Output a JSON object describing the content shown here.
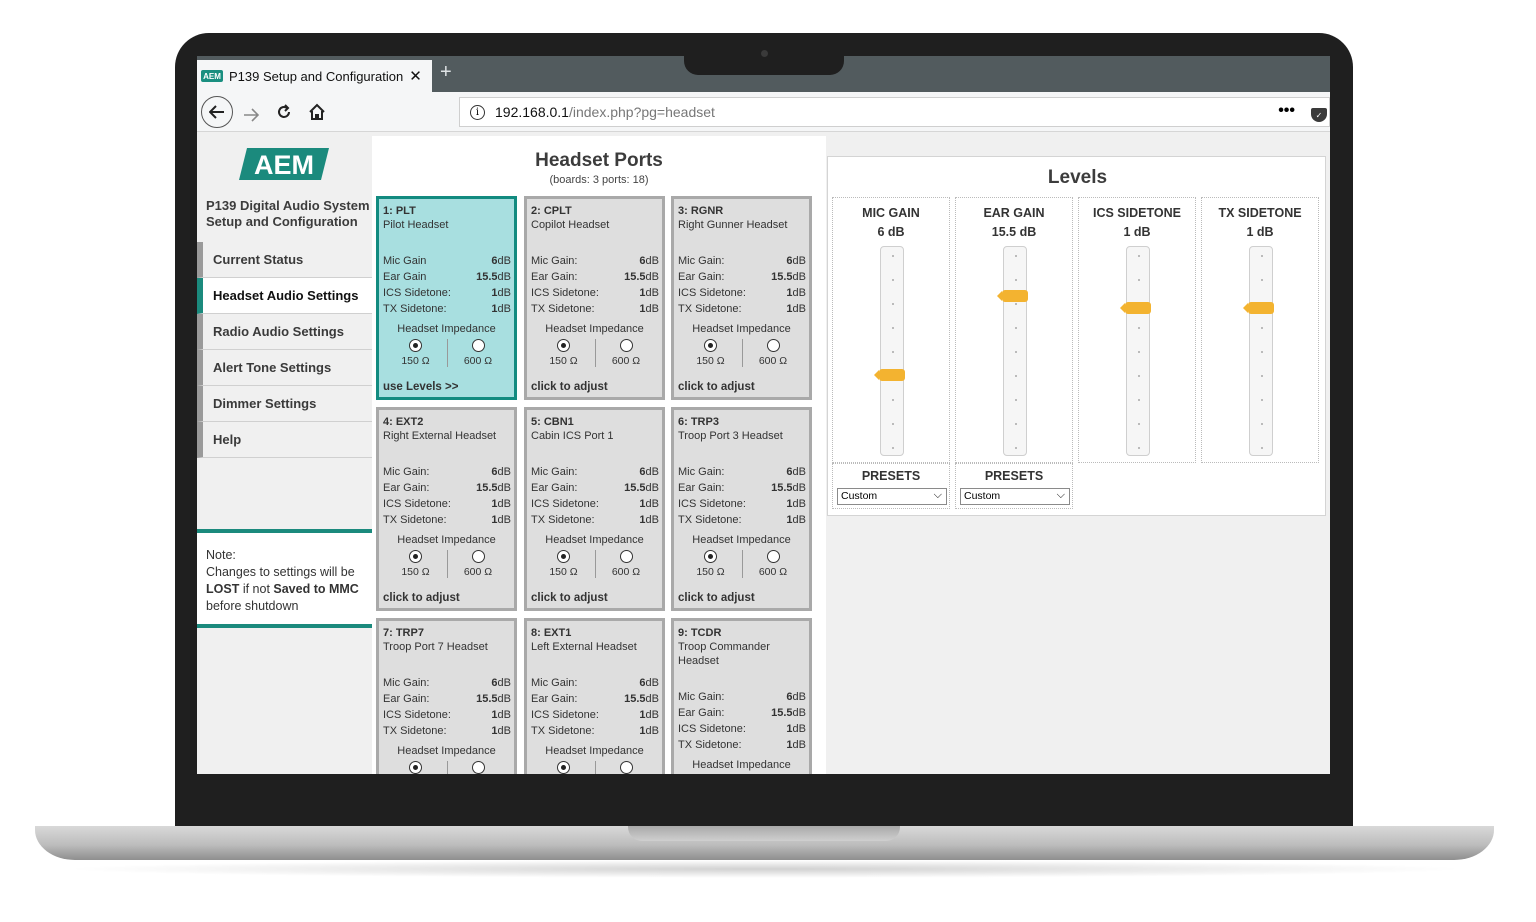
{
  "browser": {
    "tab_title": "P139 Setup and Configuration",
    "favicon_text": "AEM",
    "tab_close": "✕",
    "new_tab": "+",
    "url_host": "192.168.0.1",
    "url_path": "/index.php?pg=headset",
    "menu": "•••"
  },
  "sidebar": {
    "logo": "AEM",
    "system_title": "P139 Digital Audio System Setup and Configuration",
    "items": [
      {
        "label": "Current Status"
      },
      {
        "label": "Headset Audio Settings",
        "active": true
      },
      {
        "label": "Radio Audio Settings"
      },
      {
        "label": "Alert Tone Settings"
      },
      {
        "label": "Dimmer Settings"
      },
      {
        "label": "Help"
      }
    ],
    "note": {
      "title": "Note",
      "line1": "Changes to settings will be",
      "lost": "LOST",
      "if_not": " if not ",
      "saved": "Saved to MMC",
      "line3": "before shutdown"
    }
  },
  "headset_ports": {
    "title": "Headset Ports",
    "subtitle": "(boards: 3 ports: 18)",
    "impedance_label": "Headset Impedance",
    "imp_150": "150 Ω",
    "imp_600": "600 Ω",
    "ports": [
      {
        "id": "1: PLT",
        "name": "Pilot Headset",
        "mic_label": "Mic Gain",
        "ear_label": "Ear Gain",
        "mic": "6",
        "ear": "15.5",
        "ics": "1",
        "tx": "1",
        "footer": "use Levels >>",
        "selected": true
      },
      {
        "id": "2: CPLT",
        "name": "Copilot Headset",
        "mic_label": "Mic Gain:",
        "ear_label": "Ear Gain:",
        "mic": "6",
        "ear": "15.5",
        "ics": "1",
        "tx": "1",
        "footer": "click to adjust"
      },
      {
        "id": "3: RGNR",
        "name": "Right Gunner Headset",
        "mic_label": "Mic Gain:",
        "ear_label": "Ear Gain:",
        "mic": "6",
        "ear": "15.5",
        "ics": "1",
        "tx": "1",
        "footer": "click to adjust"
      },
      {
        "id": "4: EXT2",
        "name": "Right External Headset",
        "mic_label": "Mic Gain:",
        "ear_label": "Ear Gain:",
        "mic": "6",
        "ear": "15.5",
        "ics": "1",
        "tx": "1",
        "footer": "click to adjust"
      },
      {
        "id": "5: CBN1",
        "name": "Cabin ICS Port 1",
        "mic_label": "Mic Gain:",
        "ear_label": "Ear Gain:",
        "mic": "6",
        "ear": "15.5",
        "ics": "1",
        "tx": "1",
        "footer": "click to adjust"
      },
      {
        "id": "6: TRP3",
        "name": "Troop Port 3 Headset",
        "mic_label": "Mic Gain:",
        "ear_label": "Ear Gain:",
        "mic": "6",
        "ear": "15.5",
        "ics": "1",
        "tx": "1",
        "footer": "click to adjust"
      },
      {
        "id": "7: TRP7",
        "name": "Troop Port 7 Headset",
        "mic_label": "Mic Gain:",
        "ear_label": "Ear Gain:",
        "mic": "6",
        "ear": "15.5",
        "ics": "1",
        "tx": "1",
        "footer": ""
      },
      {
        "id": "8: EXT1",
        "name": "Left External Headset",
        "mic_label": "Mic Gain:",
        "ear_label": "Ear Gain:",
        "mic": "6",
        "ear": "15.5",
        "ics": "1",
        "tx": "1",
        "footer": ""
      },
      {
        "id": "9: TCDR",
        "name": "Troop Commander Headset",
        "mic_label": "Mic Gain:",
        "ear_label": "Ear Gain:",
        "mic": "6",
        "ear": "15.5",
        "ics": "1",
        "tx": "1",
        "footer": ""
      }
    ],
    "ics_label": "ICS Sidetone:",
    "tx_label": "TX Sidetone:",
    "unit": "dB"
  },
  "levels": {
    "title": "Levels",
    "sliders": [
      {
        "name": "MIC GAIN",
        "value": "6 dB",
        "level": 0.62
      },
      {
        "name": "EAR GAIN",
        "value": "15.5 dB",
        "level": 0.22
      },
      {
        "name": "ICS SIDETONE",
        "value": "1 dB",
        "level": 0.28
      },
      {
        "name": "TX SIDETONE",
        "value": "1 dB",
        "level": 0.28
      }
    ],
    "presets_label": "PRESETS",
    "preset_value": "Custom"
  },
  "colors": {
    "accent": "#1b8a7d",
    "selected_card": "#a8dfe0",
    "thumb": "#f3b330"
  }
}
